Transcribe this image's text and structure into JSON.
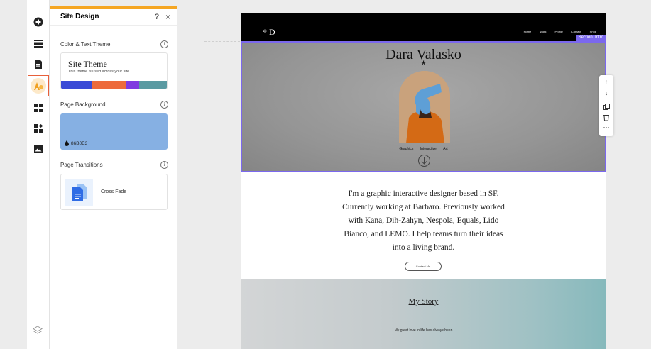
{
  "panel": {
    "title": "Site Design",
    "help_label": "?",
    "close_label": "×",
    "color_theme_label": "Color & Text Theme",
    "theme": {
      "name": "Site Theme",
      "description": "This theme is used across your site",
      "swatches": [
        "#3a4ad6",
        "#ed6a3b",
        "#7f3ae0",
        "#5a9aa2"
      ]
    },
    "page_background_label": "Page Background",
    "background": {
      "hex": "86B0E3",
      "color": "#86b0e3"
    },
    "page_transitions_label": "Page Transitions",
    "transition": {
      "label": "Cross Fade"
    },
    "info_label": "i"
  },
  "site": {
    "logo": "* D",
    "nav": [
      "Home",
      "Work",
      "Profile",
      "Contact",
      "Shop"
    ],
    "section_tag": "Section: Intro",
    "name": "Dara Valasko",
    "asterisk": "*",
    "tags": [
      "Graphics",
      "Interactive",
      "Art"
    ],
    "bio": [
      "I'm a graphic interactive designer based in SF.",
      "Currently working at Barbaro. Previously worked",
      "with Kana, Dih-Zahyn, Nespola, Equals, Lido",
      "Bianco, and LEMO. I help teams turn their ideas",
      "into a living brand."
    ],
    "contact_button": "Contact Me",
    "story_title": "My Story",
    "story_text": "My great love in life has always been"
  },
  "colors": {
    "accent": "#7b68ee",
    "panel_top": "#f5a623",
    "active_rail": "#e8603a"
  }
}
